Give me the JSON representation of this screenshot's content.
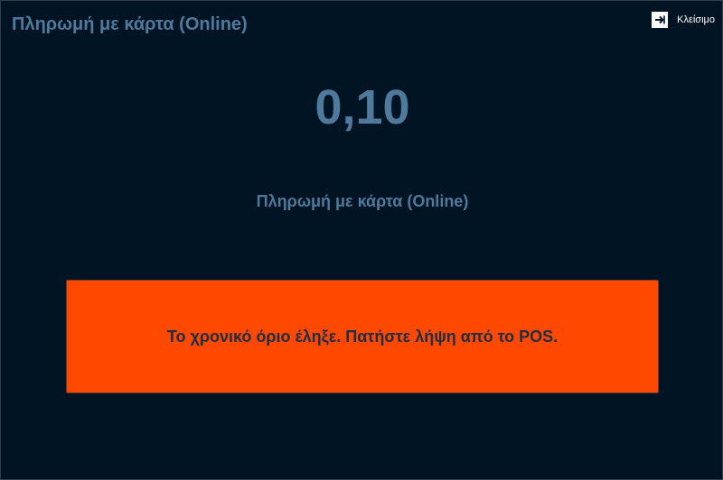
{
  "dialog": {
    "title": "Πληρωμή με κάρτα (Online)",
    "close_label": "Κλείσιμο",
    "amount": "0,10",
    "payment_method": "Πληρωμή με κάρτα (Online)",
    "alert_message": "Το χρονικό όριο έληξε. Πατήστε λήψη από το POS."
  },
  "icons": {
    "close": "exit-arrow-icon"
  },
  "colors": {
    "background": "#001424",
    "text_accent": "#4f7a9c",
    "alert_background": "#ff4800",
    "alert_text": "#1e2e44"
  }
}
